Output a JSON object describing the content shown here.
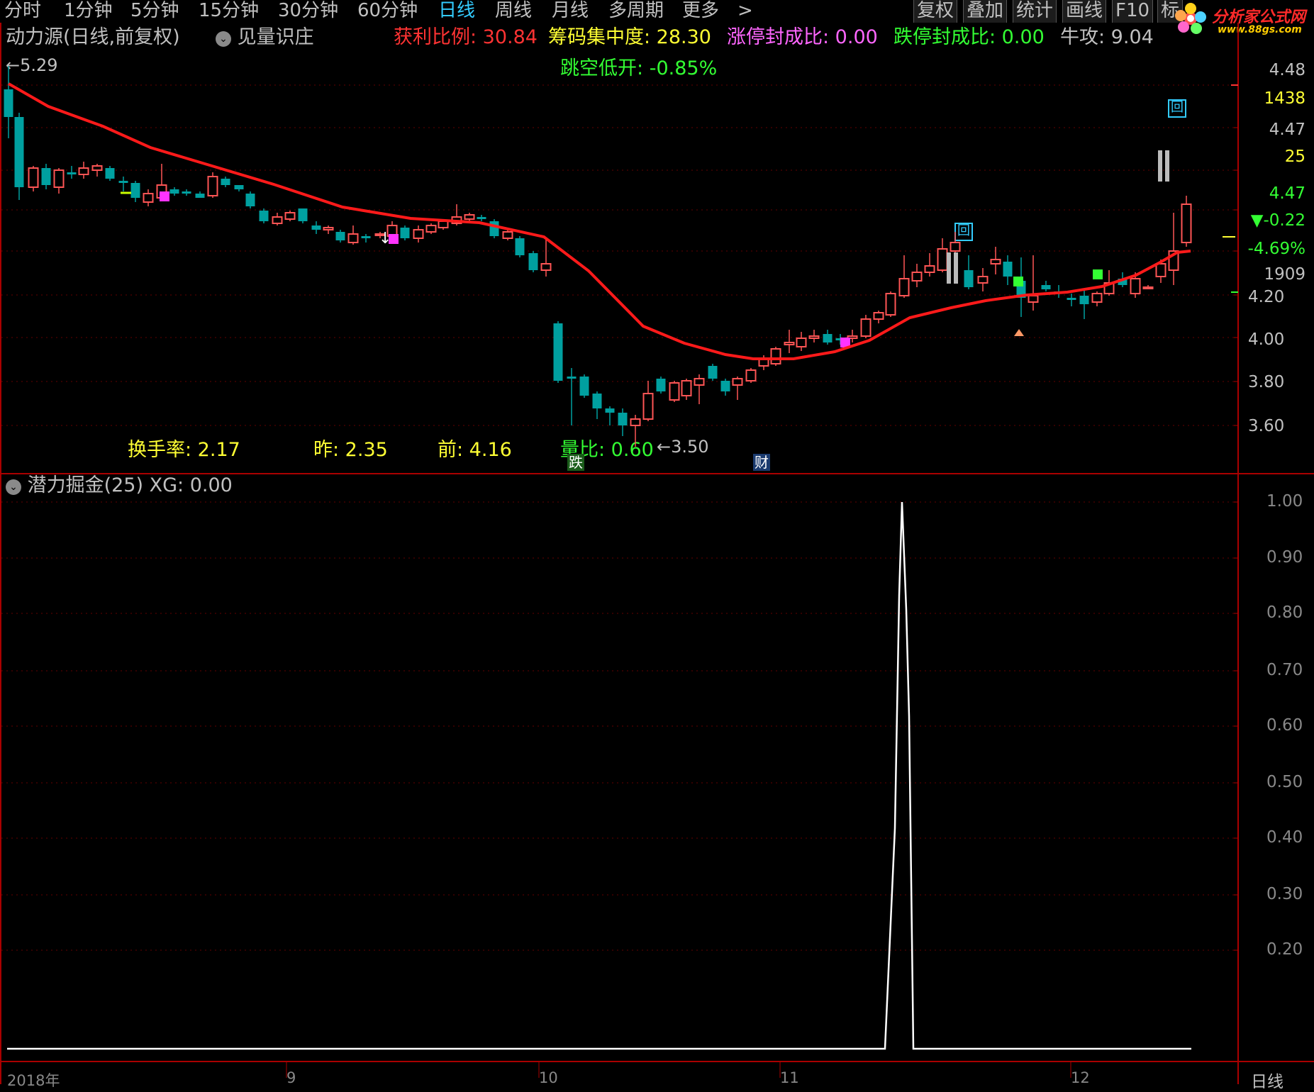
{
  "toolbar": {
    "periods": [
      "分时",
      "1分钟",
      "5分钟",
      "15分钟",
      "30分钟",
      "60分钟",
      "日线",
      "周线",
      "月线",
      "多周期",
      "更多"
    ],
    "more_arrow": ">",
    "buttons": [
      "复权",
      "叠加",
      "统计",
      "画线",
      "F10",
      "标"
    ],
    "logo_text": "分析家公式网",
    "logo_url": "www.88gs.com"
  },
  "main_panel": {
    "title": "动力源(日线,前复权)",
    "indicator": "见量识庄",
    "stats": [
      {
        "label": "获利比例:",
        "value": "30.84",
        "color": "#ff3333"
      },
      {
        "label": "筹码集中度:",
        "value": "28.30",
        "color": "#ffff33"
      },
      {
        "label": "涨停封成比:",
        "value": "0.00",
        "color": "#ff66ff"
      },
      {
        "label": "跌停封成比:",
        "value": "0.00",
        "color": "#33ff33"
      },
      {
        "label": "牛攻:",
        "value": "9.04",
        "color": "#c0c0c0"
      }
    ],
    "gap_label": "跳空低开:",
    "gap_value": "-0.85%",
    "high_mark": "←5.29",
    "low_mark": "←3.50",
    "bottom_stats": [
      {
        "label": "换手率:",
        "value": "2.17",
        "color": "#ffff33"
      },
      {
        "label": "昨:",
        "value": "2.35",
        "color": "#ffff33"
      },
      {
        "label": "前:",
        "value": "4.16",
        "color": "#ffff33"
      },
      {
        "label": "量比:",
        "value": "0.60",
        "color": "#33ff33"
      }
    ],
    "tag_die": "跌",
    "tag_cai": "财",
    "box_char": "回",
    "y_axis": [
      "4.20",
      "4.00",
      "3.80",
      "3.60"
    ],
    "info_column": [
      {
        "text": "4.48",
        "color": "#c0c0c0"
      },
      {
        "text": "1438",
        "color": "#ffff33"
      },
      {
        "text": "4.47",
        "color": "#c0c0c0"
      },
      {
        "text": "25",
        "color": "#ffff33"
      },
      {
        "text": "4.47",
        "color": "#33ff33"
      },
      {
        "text": "▼-0.22",
        "color": "#33ff33"
      },
      {
        "text": "-4.69%",
        "color": "#33ff33"
      },
      {
        "text": "1909",
        "color": "#c0c0c0"
      }
    ]
  },
  "sub_panel": {
    "title": "潜力掘金(25)",
    "xg_label": "XG:",
    "xg_value": "0.00",
    "y_axis": [
      "1.00",
      "0.90",
      "0.80",
      "0.70",
      "0.60",
      "0.50",
      "0.40",
      "0.30",
      "0.20"
    ]
  },
  "x_axis": {
    "labels": [
      "2018年",
      "9",
      "10",
      "11",
      "12"
    ],
    "period_label": "日线"
  },
  "colors": {
    "up": "#ff5555",
    "down": "#00a0a0",
    "ma": "#ff1a1a",
    "axis": "#aa0000",
    "grid": "#660000"
  }
}
